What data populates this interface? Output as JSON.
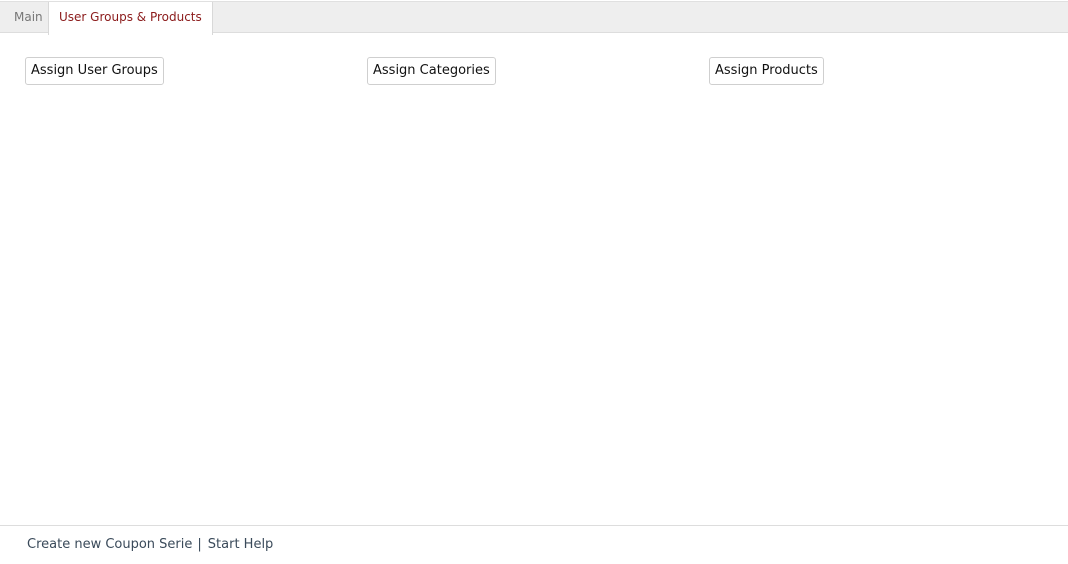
{
  "tabs": {
    "main": "Main",
    "active": "User Groups & Products"
  },
  "buttons": {
    "assign_user_groups": "Assign User Groups",
    "assign_categories": "Assign Categories",
    "assign_products": "Assign Products"
  },
  "footer": {
    "create_link": "Create new Coupon Serie",
    "separator": "|",
    "help_link": "Start Help"
  },
  "colors": {
    "active_tab_text": "#8b1a1a",
    "tabbar_bg": "#eeeeee",
    "footer_text": "#3a4a5a"
  }
}
